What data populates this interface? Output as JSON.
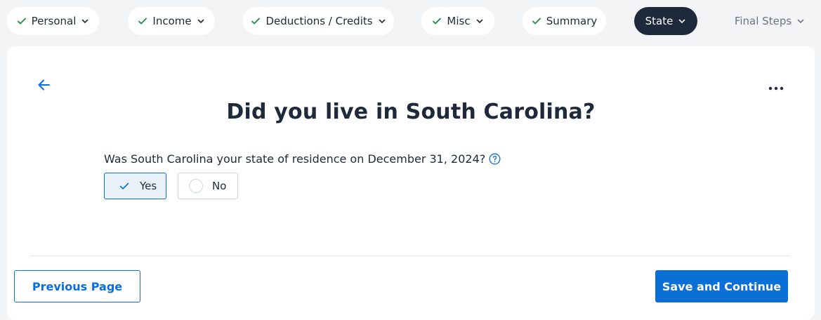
{
  "nav": {
    "personal": "Personal",
    "income": "Income",
    "deductions": "Deductions / Credits",
    "misc": "Misc",
    "summary": "Summary",
    "state": "State",
    "final_steps": "Final Steps"
  },
  "page": {
    "title": "Did you live in South Carolina?",
    "question": "Was South Carolina your state of residence on December 31, 2024?",
    "options": {
      "yes": "Yes",
      "no": "No"
    },
    "selected": "Yes"
  },
  "footer": {
    "previous_label": "Previous Page",
    "save_label": "Save and Continue"
  },
  "colors": {
    "accent": "#0b6fd8",
    "check_green": "#1a8a3a",
    "active_tab": "#1e293b"
  },
  "icons": [
    "check-icon",
    "chevron-down-icon",
    "back-arrow-icon",
    "more-options-icon",
    "help-icon"
  ]
}
